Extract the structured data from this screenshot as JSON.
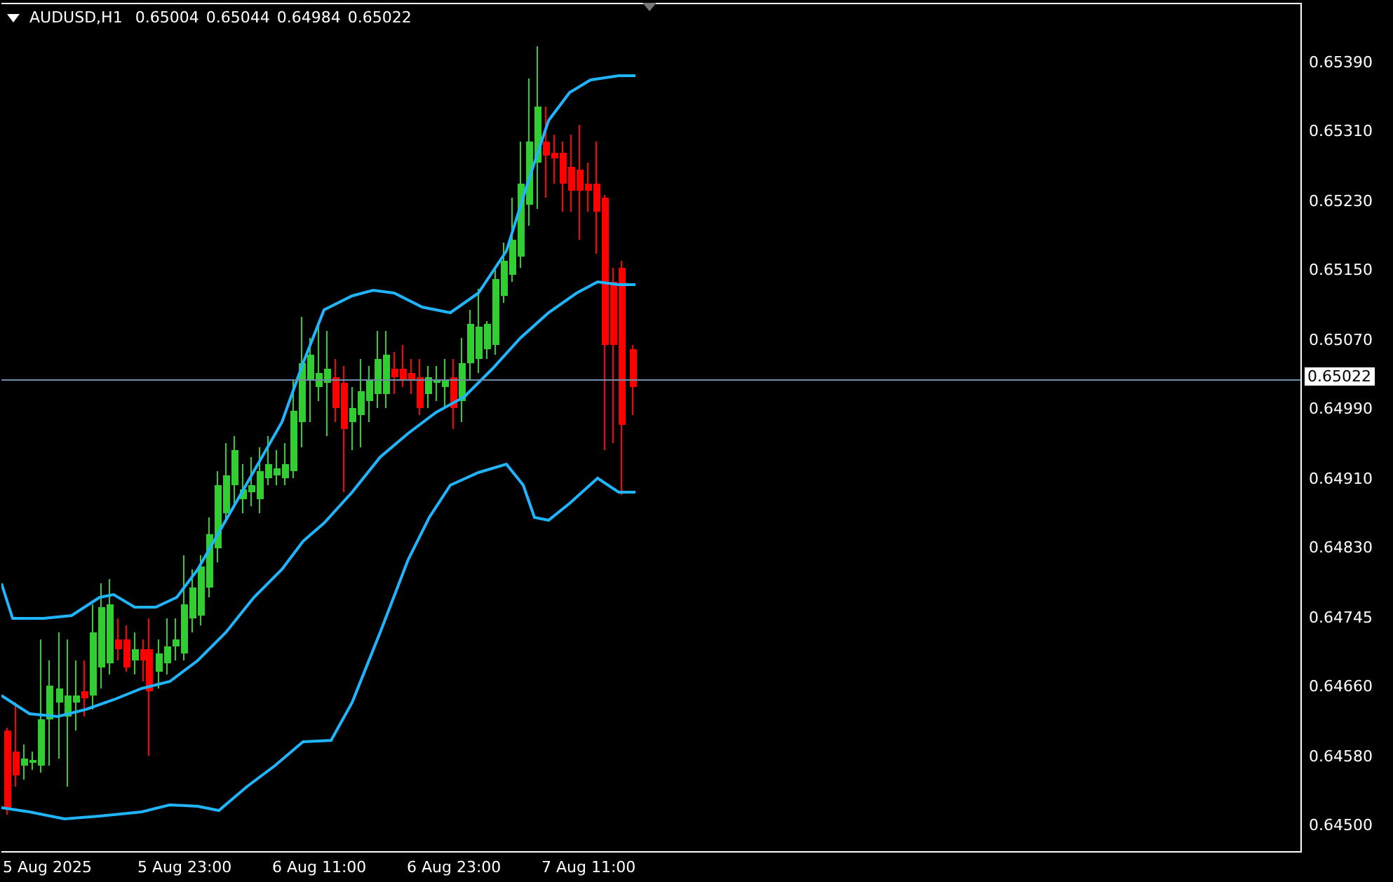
{
  "header": {
    "symbol": "AUDUSD,H1",
    "quotes": [
      "0.65004",
      "0.65044",
      "0.64984",
      "0.65022"
    ]
  },
  "price_axis": {
    "labels": [
      "0.65390",
      "0.65310",
      "0.65230",
      "0.65150",
      "0.65070",
      "0.64990",
      "0.64910",
      "0.64830",
      "0.64745",
      "0.64660",
      "0.64580",
      "0.64500"
    ],
    "current_price": "0.65022"
  },
  "time_axis": {
    "labels": [
      "5 Aug 2025",
      "5 Aug 23:00",
      "6 Aug 11:00",
      "6 Aug 23:00",
      "7 Aug 11:00"
    ]
  }
}
